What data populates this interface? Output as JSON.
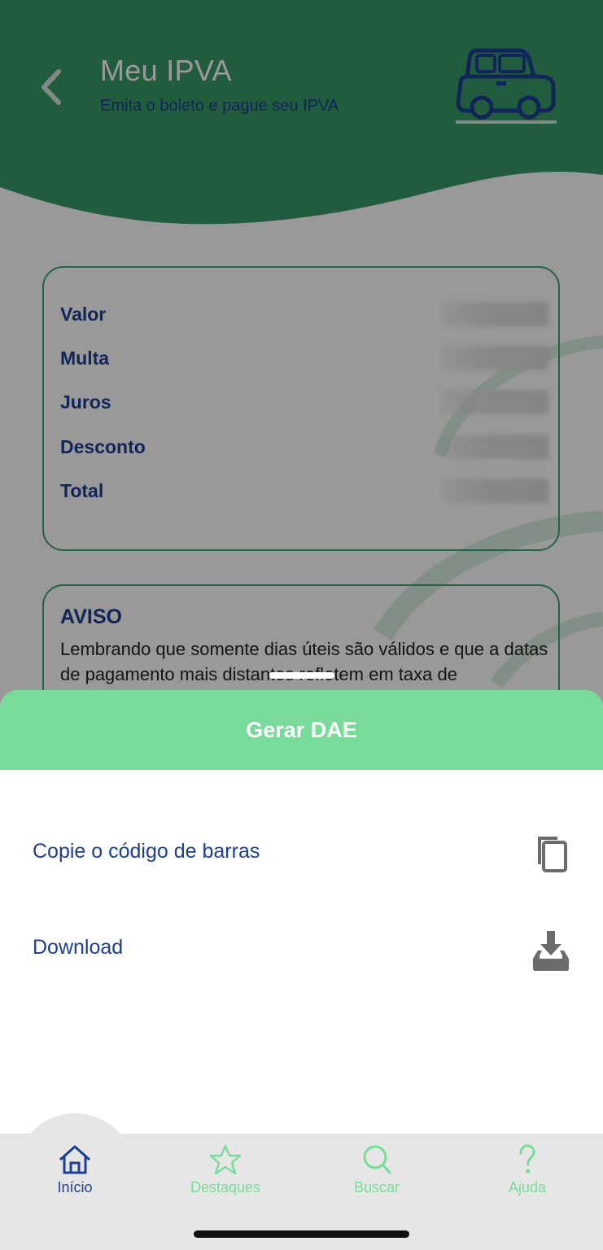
{
  "header": {
    "title": "Meu IPVA",
    "subtitle": "Emita o boleto e pague seu IPVA",
    "back_icon": "chevron-left-icon",
    "illustration": "car-icon"
  },
  "values_card": {
    "rows": [
      {
        "label": "Valor"
      },
      {
        "label": "Multa"
      },
      {
        "label": "Juros"
      },
      {
        "label": "Desconto"
      },
      {
        "label": "Total"
      }
    ]
  },
  "aviso": {
    "title": "AVISO",
    "text": "Lembrando que somente dias úteis são válidos e que a datas de pagamento mais distantes refletem em taxa de"
  },
  "sheet": {
    "title": "Gerar DAE",
    "options": [
      {
        "label": "Copie o código de barras",
        "icon": "copy-icon"
      },
      {
        "label": "Download",
        "icon": "download-icon"
      }
    ]
  },
  "tabbar": {
    "tabs": [
      {
        "label": "Início",
        "icon": "home-icon",
        "active": true
      },
      {
        "label": "Destaques",
        "icon": "star-icon",
        "active": false
      },
      {
        "label": "Buscar",
        "icon": "search-icon",
        "active": false
      },
      {
        "label": "Ajuda",
        "icon": "help-icon",
        "active": false
      }
    ]
  },
  "colors": {
    "brand_green": "#3a9a68",
    "sheet_green": "#79db9a",
    "brand_blue": "#1d3f93"
  }
}
